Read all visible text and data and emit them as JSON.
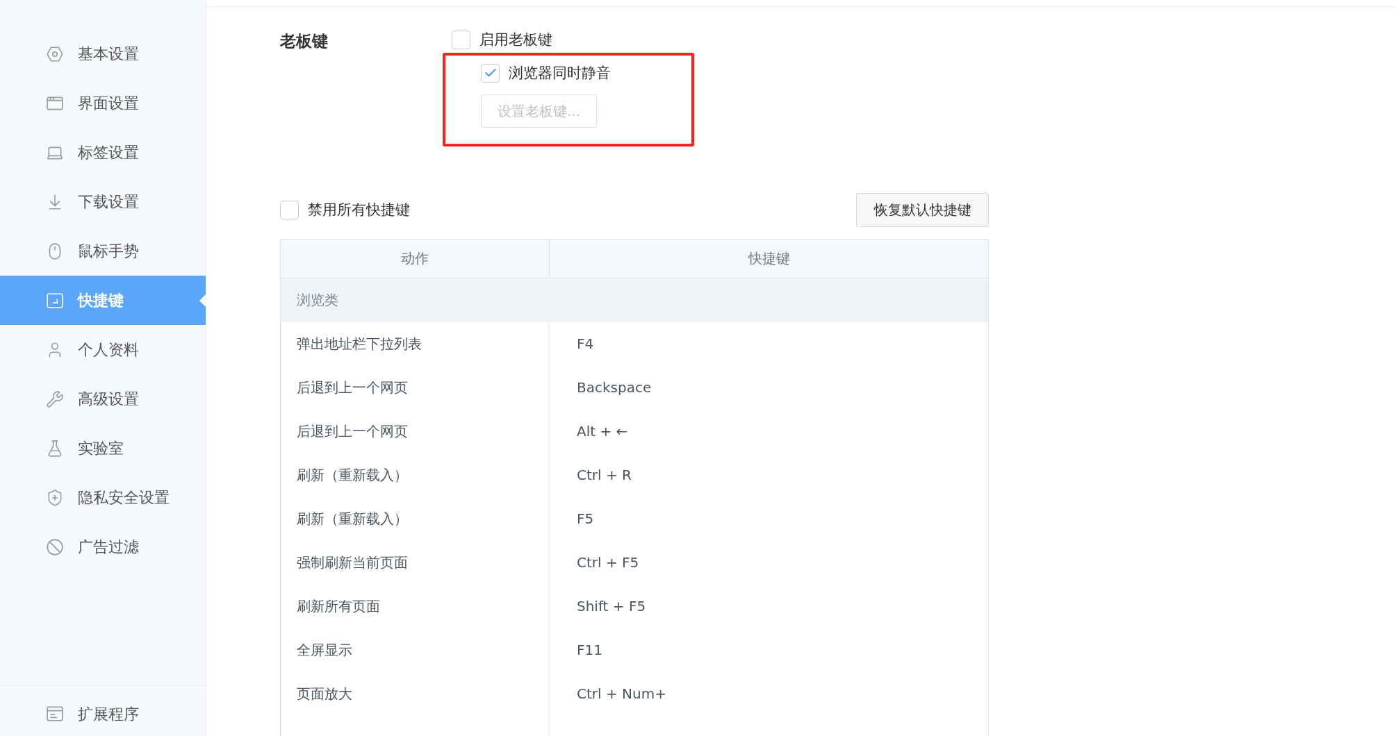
{
  "sidebar": {
    "items": [
      {
        "label": "基本设置",
        "selected": false
      },
      {
        "label": "界面设置",
        "selected": false
      },
      {
        "label": "标签设置",
        "selected": false
      },
      {
        "label": "下载设置",
        "selected": false
      },
      {
        "label": "鼠标手势",
        "selected": false
      },
      {
        "label": "快捷键",
        "selected": true
      },
      {
        "label": "个人资料",
        "selected": false
      },
      {
        "label": "高级设置",
        "selected": false
      },
      {
        "label": "实验室",
        "selected": false
      },
      {
        "label": "隐私安全设置",
        "selected": false
      },
      {
        "label": "广告过滤",
        "selected": false
      }
    ],
    "footer_item": {
      "label": "扩展程序",
      "selected": false
    }
  },
  "boss_key": {
    "title": "老板键",
    "enable": {
      "label": "启用老板键",
      "checked": false
    },
    "mute": {
      "label": "浏览器同时静音",
      "checked": true
    },
    "set_button": {
      "label": "设置老板键...",
      "disabled": true
    }
  },
  "disable_all": {
    "label": "禁用所有快捷键",
    "checked": false
  },
  "restore_button": "恢复默认快捷键",
  "table": {
    "columns": [
      "动作",
      "快捷键"
    ],
    "group": "浏览类",
    "rows": [
      {
        "action": "弹出地址栏下拉列表",
        "shortcut": "F4"
      },
      {
        "action": "后退到上一个网页",
        "shortcut": "Backspace"
      },
      {
        "action": "后退到上一个网页",
        "shortcut": "Alt + ←"
      },
      {
        "action": "刷新（重新载入）",
        "shortcut": "Ctrl + R"
      },
      {
        "action": "刷新（重新载入）",
        "shortcut": "F5"
      },
      {
        "action": "强制刷新当前页面",
        "shortcut": "Ctrl + F5"
      },
      {
        "action": "刷新所有页面",
        "shortcut": "Shift + F5"
      },
      {
        "action": "全屏显示",
        "shortcut": "F11"
      },
      {
        "action": "页面放大",
        "shortcut": "Ctrl + Num+"
      }
    ]
  }
}
